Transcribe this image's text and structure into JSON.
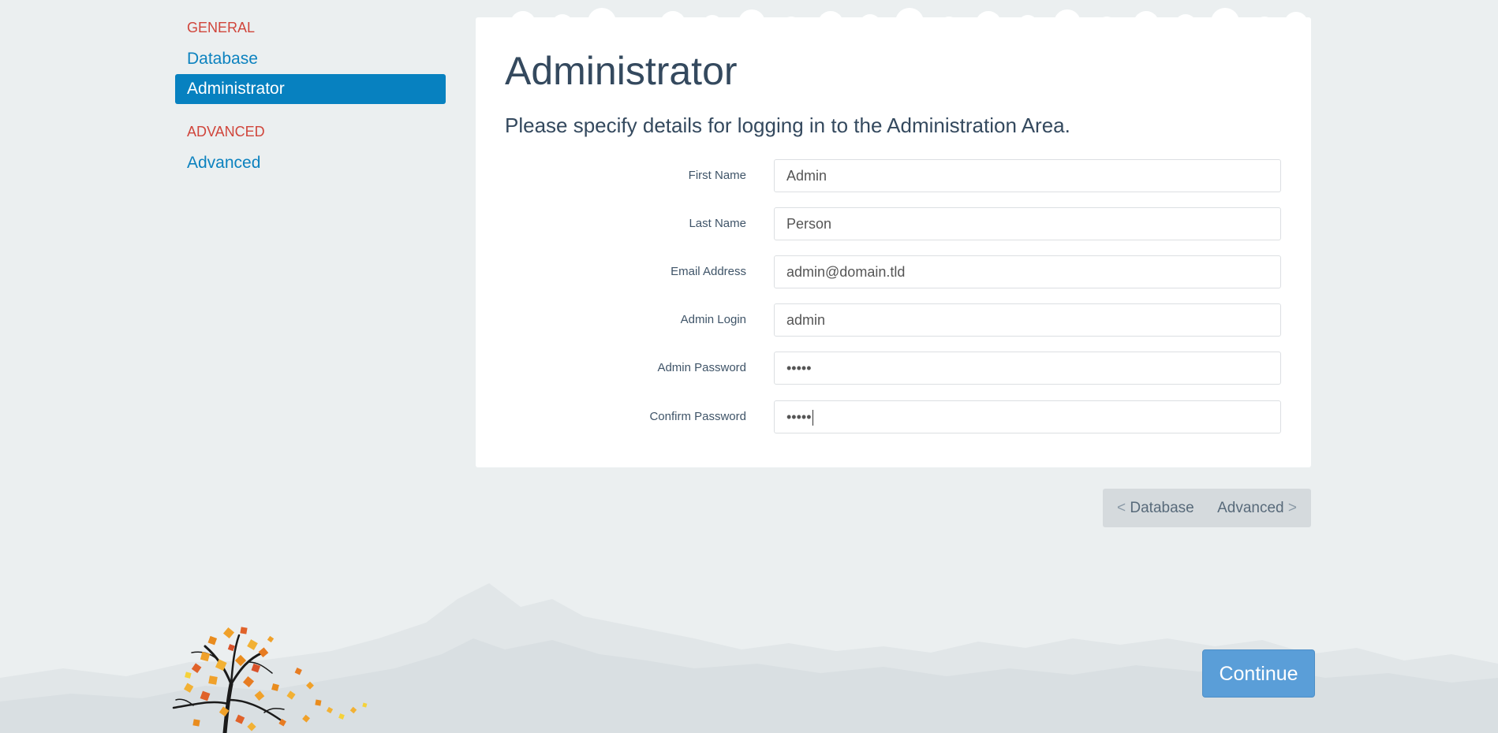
{
  "sidebar": {
    "sections": [
      {
        "heading": "GENERAL",
        "items": [
          {
            "label": "Database",
            "active": false
          },
          {
            "label": "Administrator",
            "active": true
          }
        ]
      },
      {
        "heading": "ADVANCED",
        "items": [
          {
            "label": "Advanced",
            "active": false
          }
        ]
      }
    ]
  },
  "page": {
    "title": "Administrator",
    "subtitle": "Please specify details for logging in to the Administration Area."
  },
  "form": {
    "fields": [
      {
        "label": "First Name",
        "value": "Admin"
      },
      {
        "label": "Last Name",
        "value": "Person"
      },
      {
        "label": "Email Address",
        "value": "admin@domain.tld"
      },
      {
        "label": "Admin Login",
        "value": "admin"
      },
      {
        "label": "Admin Password",
        "value": "•••••"
      },
      {
        "label": "Confirm Password",
        "value": "•••••"
      }
    ]
  },
  "stepnav": {
    "prev_arrow": "<",
    "prev_label": "Database",
    "next_label": "Advanced",
    "next_arrow": ">"
  },
  "actions": {
    "continue_label": "Continue"
  },
  "colors": {
    "background": "#ebeff0",
    "accent": "#0781c0",
    "section_heading": "#d0453b",
    "continue_button": "#5a9ed8"
  }
}
